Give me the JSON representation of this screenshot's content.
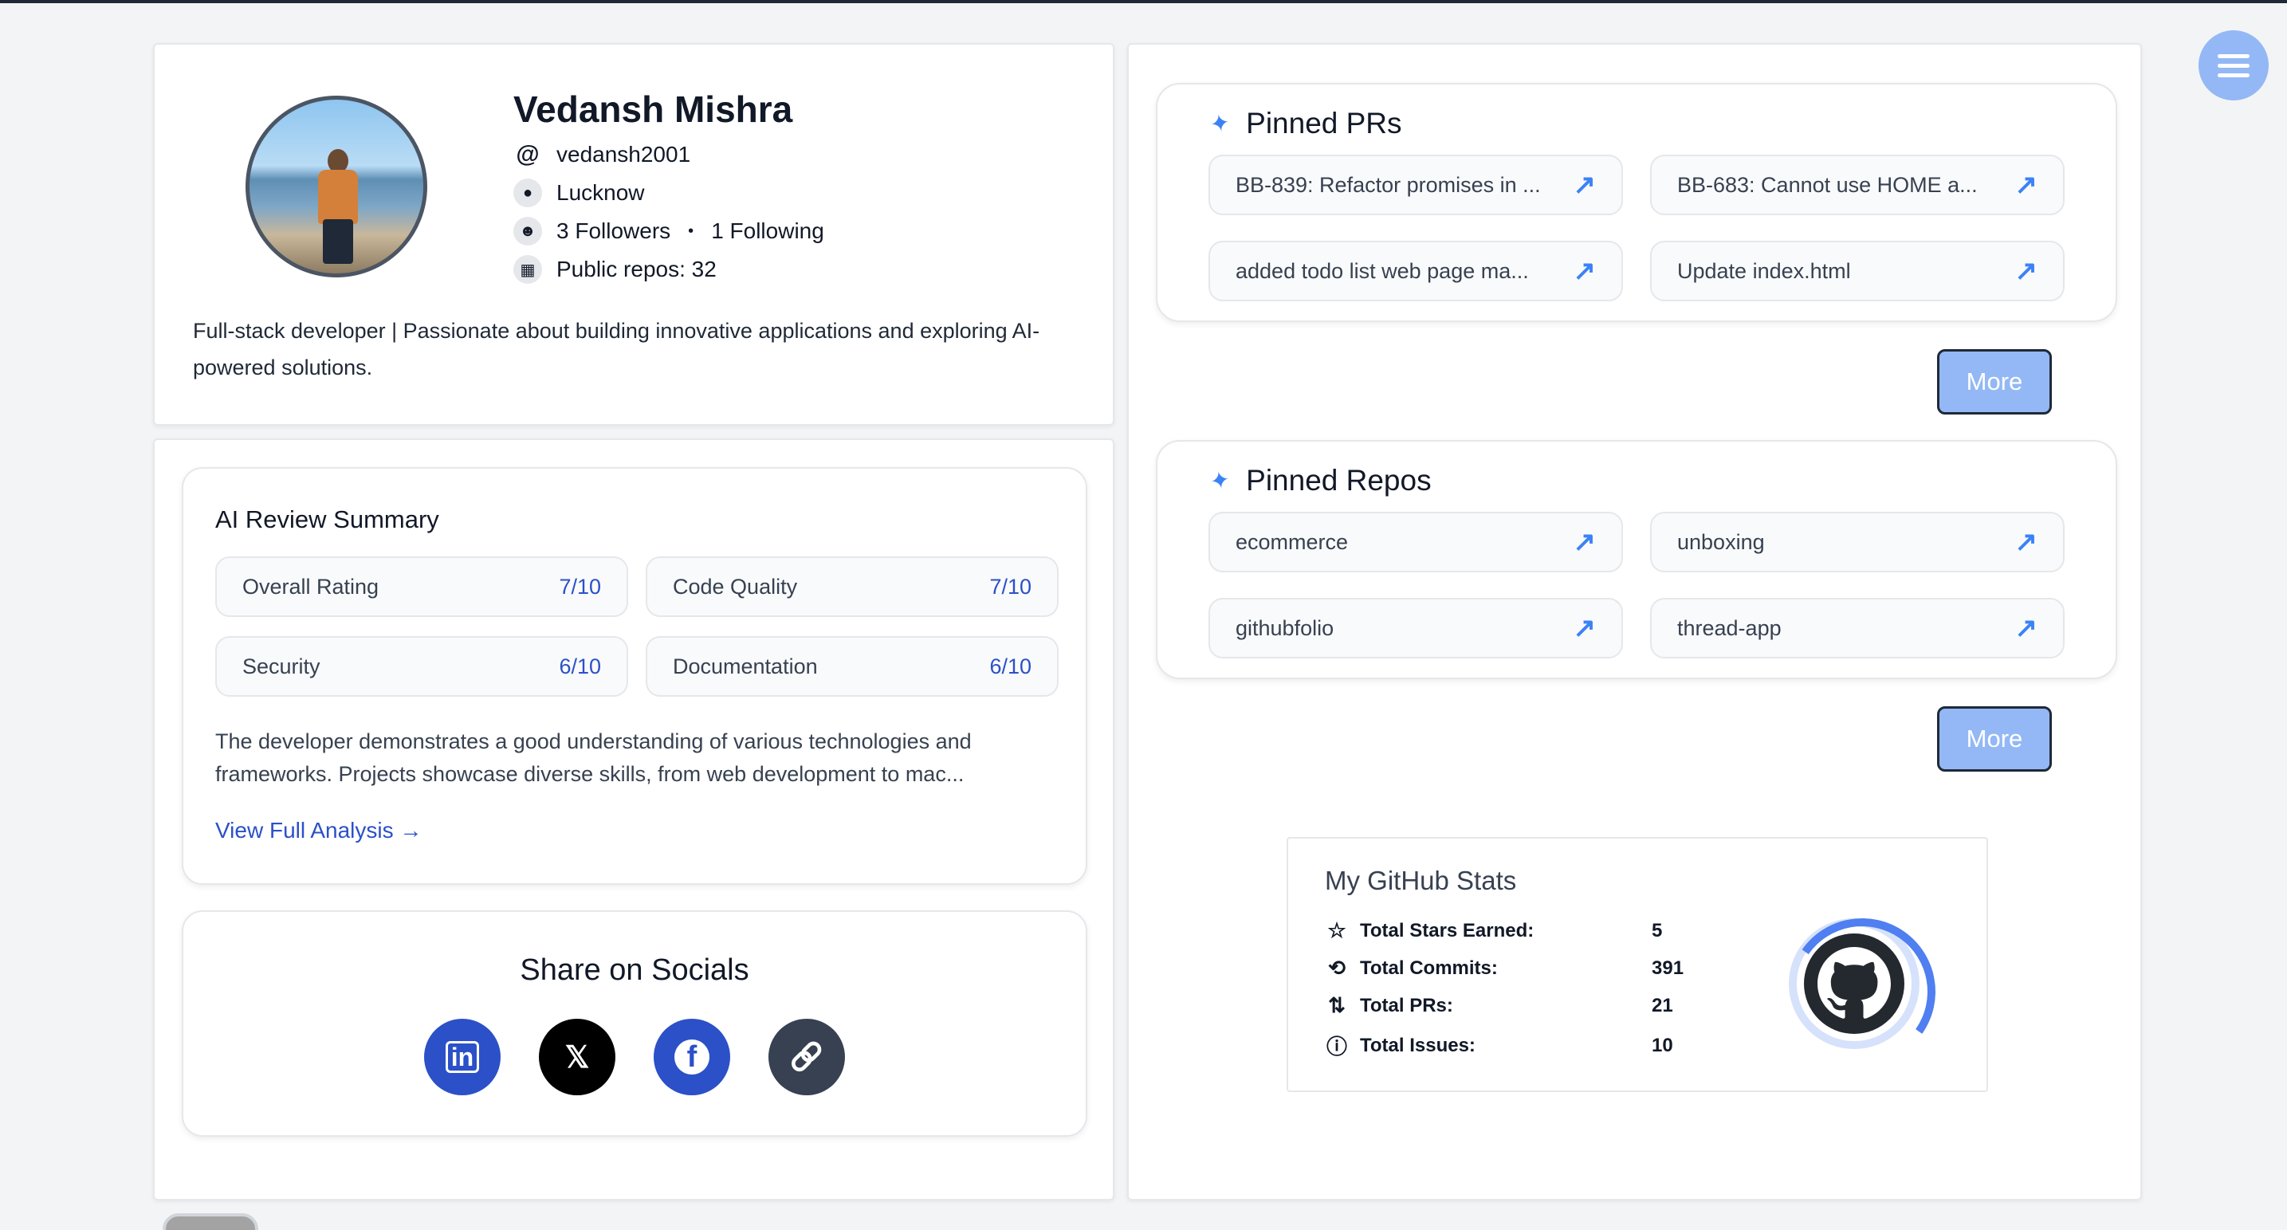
{
  "profile": {
    "name": "Vedansh Mishra",
    "username": "vedansh2001",
    "location": "Lucknow",
    "followers": "3 Followers",
    "following": "1 Following",
    "public_repos": "Public repos: 32",
    "bio": "Full-stack developer | Passionate about building innovative applications and exploring AI-powered solutions."
  },
  "ai_review": {
    "title": "AI Review Summary",
    "metrics": [
      {
        "label": "Overall Rating",
        "value": "7/10"
      },
      {
        "label": "Code Quality",
        "value": "7/10"
      },
      {
        "label": "Security",
        "value": "6/10"
      },
      {
        "label": "Documentation",
        "value": "6/10"
      }
    ],
    "summary": "The developer demonstrates a good understanding of various technologies and frameworks.  Projects showcase diverse skills, from web development to mac...",
    "link": "View Full Analysis →"
  },
  "share": {
    "title": "Share on Socials",
    "buttons": [
      {
        "name": "linkedin",
        "glyph": "in",
        "color": "#2b50c8"
      },
      {
        "name": "x",
        "glyph": "𝕏",
        "color": "#000000"
      },
      {
        "name": "facebook",
        "glyph": "f",
        "color": "#2b50c8"
      },
      {
        "name": "copy-link",
        "glyph": "🔗",
        "color": "#374151"
      }
    ]
  },
  "pinned_prs": {
    "title": "Pinned PRs",
    "items": [
      "BB-839: Refactor promises in ...",
      "BB-683: Cannot use HOME a...",
      "added todo list web page ma...",
      "Update index.html"
    ],
    "more": "More"
  },
  "pinned_repos": {
    "title": "Pinned Repos",
    "items": [
      "ecommerce",
      "unboxing",
      "githubfolio",
      "thread-app"
    ],
    "more": "More"
  },
  "stats": {
    "title": "My GitHub Stats",
    "rows": [
      {
        "icon": "star-icon",
        "glyph": "☆",
        "label": "Total Stars Earned:",
        "value": "5"
      },
      {
        "icon": "history-icon",
        "glyph": "⟲",
        "label": "Total Commits:",
        "value": "391"
      },
      {
        "icon": "pull-request-icon",
        "glyph": "⇅",
        "label": "Total PRs:",
        "value": "21"
      },
      {
        "icon": "issue-icon",
        "glyph": "ⓘ",
        "label": "Total Issues:",
        "value": "10"
      }
    ]
  }
}
